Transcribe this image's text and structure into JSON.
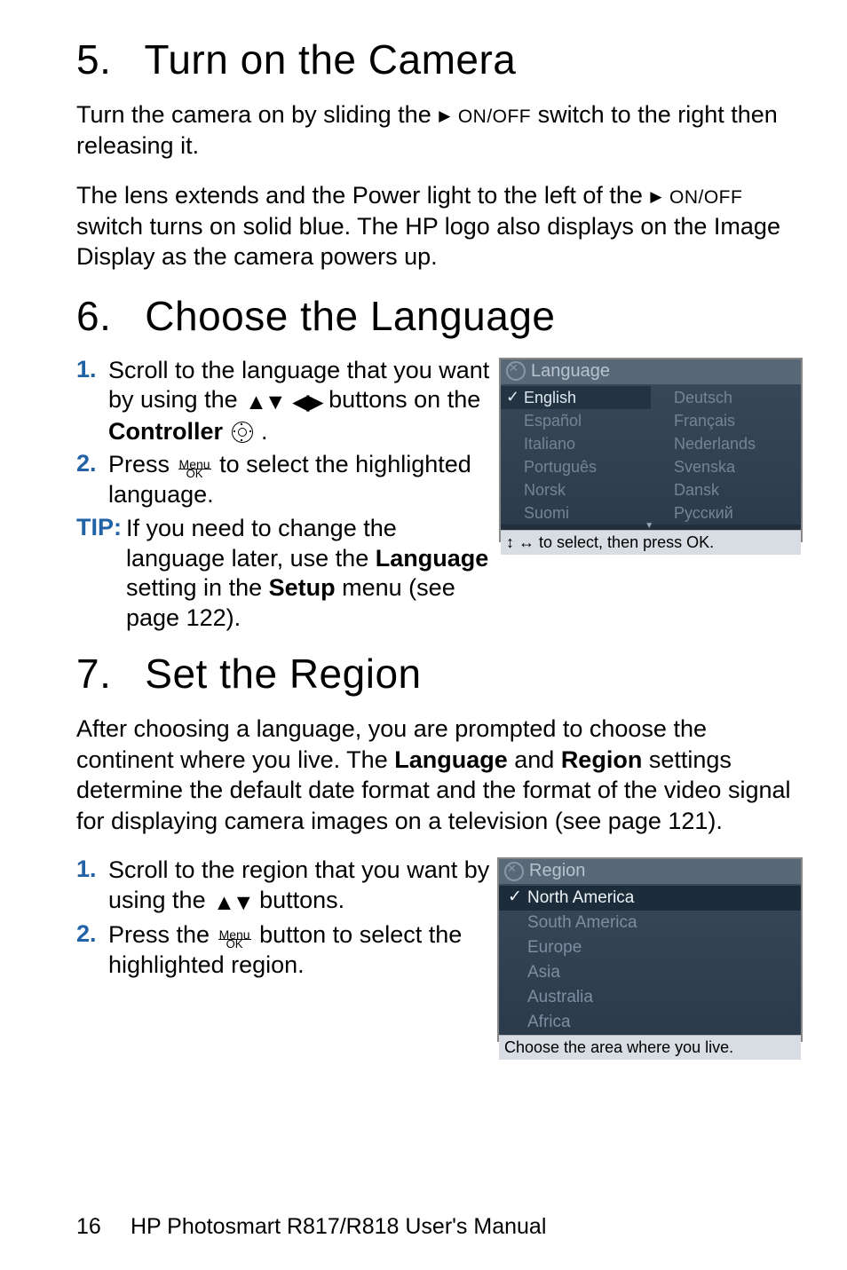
{
  "sections": {
    "s5": {
      "num": "5.",
      "title": "Turn on the Camera"
    },
    "s6": {
      "num": "6.",
      "title": "Choose the Language"
    },
    "s7": {
      "num": "7.",
      "title": "Set the Region"
    }
  },
  "onoff_label": "ON/OFF",
  "menuok": {
    "top": "Menu",
    "bot": "OK"
  },
  "s5_p1a": "Turn the camera on by sliding the ",
  "s5_p1b": " switch to the right then releasing it.",
  "s5_p2a": "The lens extends and the Power light to the left of the ",
  "s5_p2b": " switch turns on solid blue. The HP logo also displays on the Image Display as the camera powers up.",
  "s6_item1a": "Scroll to the language that you want by using the ",
  "s6_item1b": " buttons on the ",
  "s6_controller_word": "Controller",
  "s6_item1c": " .",
  "s6_item2a": "Press ",
  "s6_item2b": " to select the highlighted language.",
  "s6_tip_label": "TIP:",
  "s6_tip_a": "If you need to change the language later, use the ",
  "s6_tip_lang": "Language",
  "s6_tip_b": " setting in the ",
  "s6_tip_setup": "Setup",
  "s6_tip_c": " menu (see page 122).",
  "s7_p1a": "After choosing a language, you are prompted to choose the continent where you live. The ",
  "s7_lang": "Language",
  "s7_and": " and ",
  "s7_region": "Region",
  "s7_p1b": " settings determine the default date format and the format of the video signal for displaying camera images on a television (see page 121).",
  "s7_item1a": "Scroll to the region that you want by using the ",
  "s7_item1b": " buttons.",
  "s7_item2a": "Press the ",
  "s7_item2b": " button to select the highlighted region.",
  "list_nums": {
    "one": "1.",
    "two": "2."
  },
  "cam_lang": {
    "title": "Language",
    "left": [
      "English",
      "Español",
      "Italiano",
      "Português",
      "Norsk",
      "Suomi"
    ],
    "right": [
      "Deutsch",
      "Français",
      "Nederlands",
      "Svenska",
      "Dansk",
      "Русский"
    ],
    "selected": "English",
    "foot_pre": "",
    "foot": " to select, then press OK."
  },
  "cam_region": {
    "title": "Region",
    "items": [
      "North America",
      "South America",
      "Europe",
      "Asia",
      "Australia",
      "Africa"
    ],
    "selected": "North America",
    "foot": "Choose the area where you live."
  },
  "footer": {
    "page": "16",
    "title": "HP Photosmart R817/R818 User's Manual"
  }
}
